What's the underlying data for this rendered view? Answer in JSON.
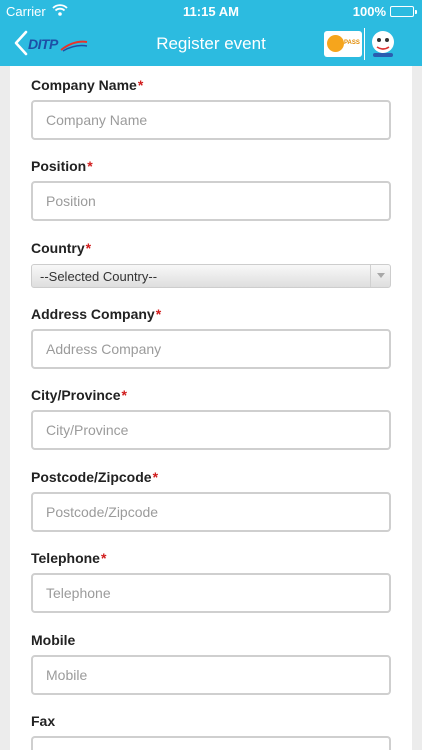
{
  "status_bar": {
    "carrier": "Carrier",
    "time": "11:15 AM",
    "battery": "100%",
    "battery_level": 1.0
  },
  "nav": {
    "title": "Register event",
    "back_logo_text": "DITP",
    "badge_text": "PASS"
  },
  "form": {
    "required_mark": "*",
    "company_name": {
      "label": "Company Name",
      "placeholder": "Company Name",
      "value": ""
    },
    "position": {
      "label": "Position",
      "placeholder": "Position",
      "value": ""
    },
    "country": {
      "label": "Country",
      "selected": "--Selected Country--"
    },
    "address_company": {
      "label": "Address Company",
      "placeholder": "Address Company",
      "value": ""
    },
    "city_province": {
      "label": "City/Province",
      "placeholder": "City/Province",
      "value": ""
    },
    "postcode": {
      "label": "Postcode/Zipcode",
      "placeholder": "Postcode/Zipcode",
      "value": ""
    },
    "telephone": {
      "label": "Telephone",
      "placeholder": "Telephone",
      "value": ""
    },
    "mobile": {
      "label": "Mobile",
      "placeholder": "Mobile",
      "value": ""
    },
    "fax": {
      "label": "Fax",
      "placeholder": "",
      "value": ""
    }
  },
  "colors": {
    "nav_background": "#2cbbe0",
    "required": "#d01c1c"
  },
  "icons": [
    "wifi-icon",
    "battery-icon",
    "back-chevron-icon",
    "ditp-logo",
    "pass-logo",
    "mascot-logo",
    "dropdown-arrow-icon"
  ]
}
